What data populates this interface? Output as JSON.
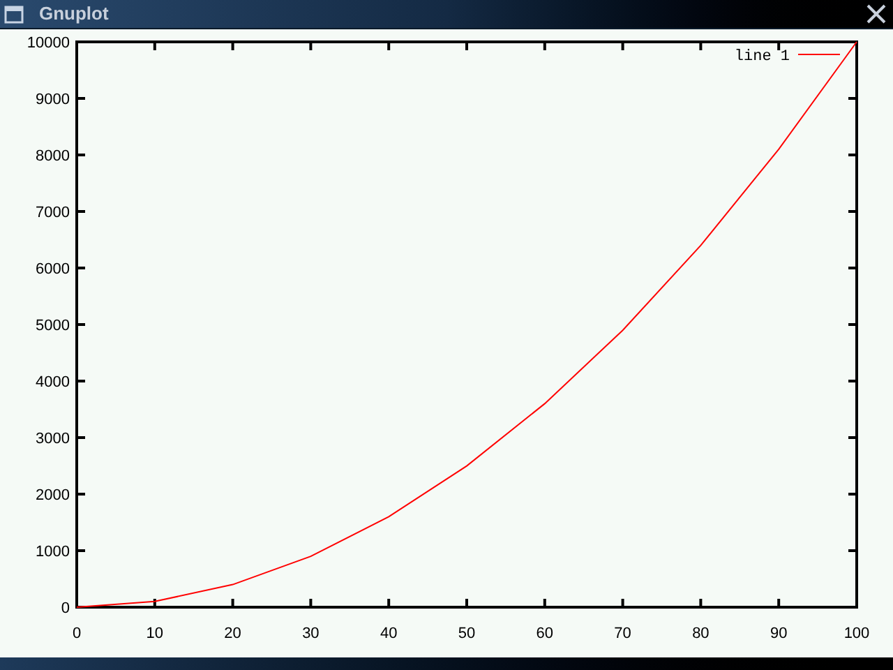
{
  "window": {
    "title": "Gnuplot"
  },
  "plot": {
    "chart_data": {
      "type": "line",
      "x": [
        0,
        10,
        20,
        30,
        40,
        50,
        60,
        70,
        80,
        90,
        100
      ],
      "series": [
        {
          "name": "line 1",
          "color": "#ff0000",
          "values": [
            0,
            100,
            400,
            900,
            1600,
            2500,
            3600,
            4900,
            6400,
            8100,
            10000
          ]
        }
      ],
      "xlim": [
        0,
        100
      ],
      "ylim": [
        0,
        10000
      ],
      "xticks": [
        0,
        10,
        20,
        30,
        40,
        50,
        60,
        70,
        80,
        90,
        100
      ],
      "yticks": [
        0,
        1000,
        2000,
        3000,
        4000,
        5000,
        6000,
        7000,
        8000,
        9000,
        10000
      ]
    }
  }
}
